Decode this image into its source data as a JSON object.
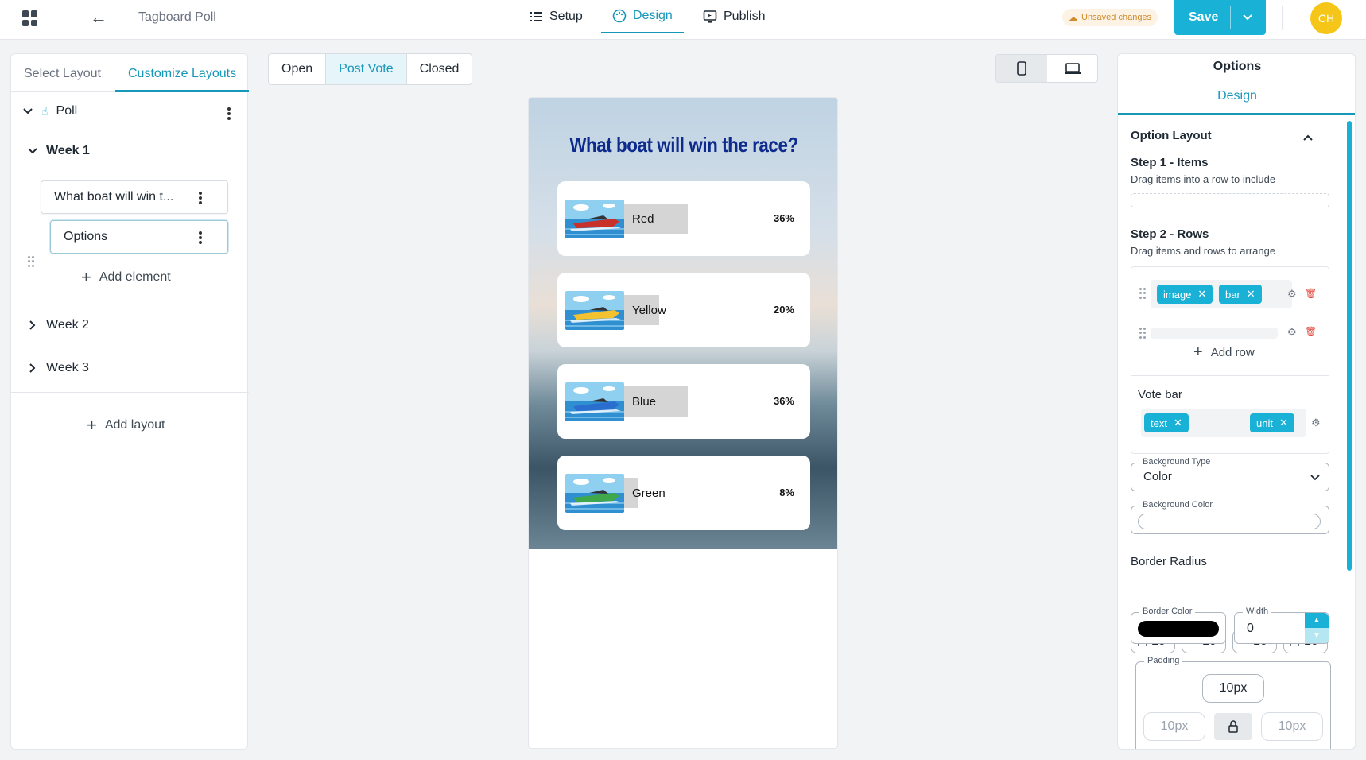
{
  "header": {
    "app_title": "Tagboard Poll",
    "tabs": [
      {
        "label": "Setup",
        "icon": "list-icon"
      },
      {
        "label": "Design",
        "icon": "palette-icon"
      },
      {
        "label": "Publish",
        "icon": "monitor-icon"
      }
    ],
    "unsaved_label": "Unsaved changes",
    "save_label": "Save",
    "avatar_initials": "CH",
    "accent_color": "#19b1d6"
  },
  "left_panel": {
    "tabs": [
      "Select Layout",
      "Customize Layouts"
    ],
    "root_label": "Poll",
    "groups": [
      {
        "label": "Week 1",
        "expanded": true
      },
      {
        "label": "Week 2",
        "expanded": false
      },
      {
        "label": "Week 3",
        "expanded": false
      }
    ],
    "elements": [
      "What boat will win t...",
      "Options"
    ],
    "add_element_label": "Add element",
    "add_layout_label": "Add layout"
  },
  "state_tabs": [
    "Open",
    "Post Vote",
    "Closed"
  ],
  "state_tabs_selected": "Post Vote",
  "preview": {
    "question": "What boat will win the race?",
    "options": [
      {
        "label": "Red",
        "percent": "36%",
        "value": 36,
        "boat_color": "#c8302a"
      },
      {
        "label": "Yellow",
        "percent": "20%",
        "value": 20,
        "boat_color": "#f2c230"
      },
      {
        "label": "Blue",
        "percent": "36%",
        "value": 36,
        "boat_color": "#2a6fd0"
      },
      {
        "label": "Green",
        "percent": "8%",
        "value": 8,
        "boat_color": "#3ea84a"
      }
    ]
  },
  "right_panel": {
    "title": "Options",
    "tab": "Design",
    "section_title": "Option Layout",
    "step1_title": "Step 1 - Items",
    "step1_desc": "Drag items into a row to include",
    "step2_title": "Step 2 - Rows",
    "step2_desc": "Drag items and rows to arrange",
    "row1_chips": [
      "image",
      "bar"
    ],
    "add_row_label": "Add row",
    "vote_bar_title": "Vote bar",
    "vote_bar_chips": [
      "text",
      "unit"
    ],
    "background_type_label": "Background Type",
    "background_type_value": "Color",
    "background_color_label": "Background Color",
    "border_radius_title": "Border Radius",
    "border_radius_values": [
      "10",
      "10",
      "10",
      "10"
    ],
    "border_color_label": "Border Color",
    "border_color_value": "#000000",
    "width_label": "Width",
    "width_value": "0",
    "padding_label": "Padding",
    "padding_values": [
      "10px",
      "10px",
      "10px"
    ]
  }
}
